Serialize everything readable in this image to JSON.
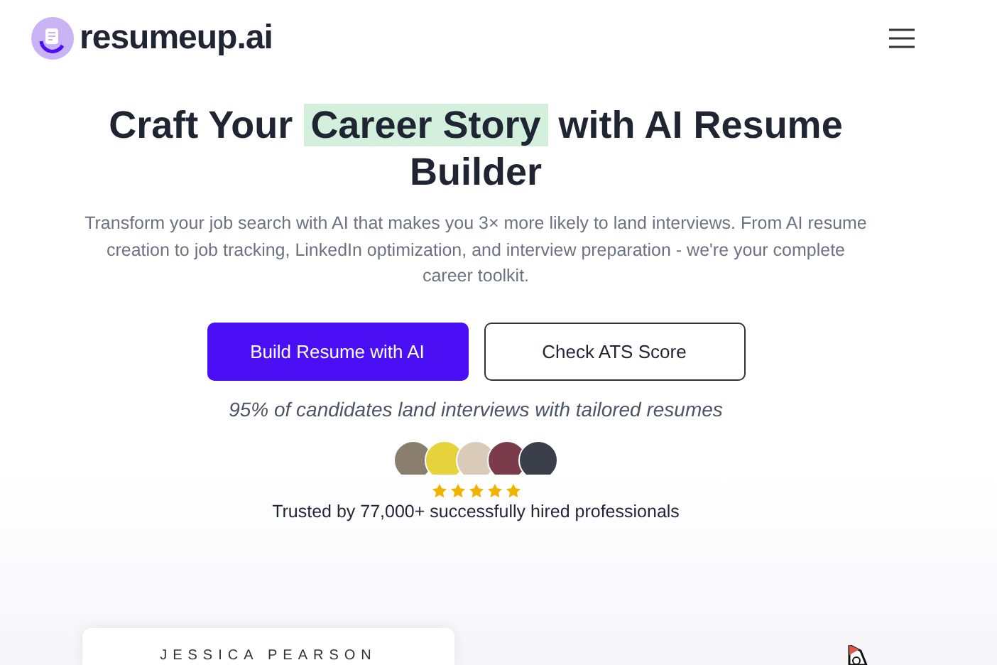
{
  "header": {
    "logo_text": "resumeup.ai"
  },
  "hero": {
    "title_before": "Craft Your",
    "title_highlight": "Career Story",
    "title_after": "with AI Resume Builder",
    "subtitle": "Transform your job search with AI that makes you 3× more likely to land interviews. From AI resume creation to job tracking, LinkedIn optimization, and interview preparation - we're your complete career toolkit.",
    "buttons": [
      {
        "label": "Build Resume with AI",
        "kind": "primary"
      },
      {
        "label": "Check ATS Score",
        "kind": "outline"
      }
    ],
    "tagline": "95% of candidates land interviews with tailored resumes",
    "avatars": [
      {
        "color": "#8a7f6e"
      },
      {
        "color": "#e6d23a"
      },
      {
        "color": "#d9cbb8"
      },
      {
        "color": "#7a3b4a"
      },
      {
        "color": "#3a3f4a"
      }
    ],
    "rating": {
      "stars": 5
    },
    "trust_text": "Trusted by 77,000+ successfully hired professionals"
  },
  "preview": {
    "name": "JESSICA PEARSON"
  }
}
